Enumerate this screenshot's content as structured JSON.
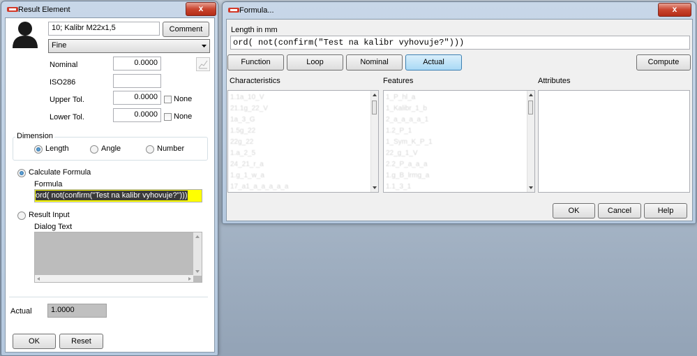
{
  "result_window": {
    "title": "Result Element",
    "close_label": "x",
    "name_value": "10; Kalibr M22x1,5",
    "comment_label": "Comment",
    "quality_select": "Fine",
    "nominal_label": "Nominal",
    "nominal_value": "0.0000",
    "iso_label": "ISO286",
    "iso_value": "",
    "upper_label": "Upper Tol.",
    "upper_value": "0.0000",
    "upper_none": "None",
    "lower_label": "Lower Tol.",
    "lower_value": "0.0000",
    "lower_none": "None",
    "dimension_label": "Dimension",
    "dim_length": "Length",
    "dim_angle": "Angle",
    "dim_number": "Number",
    "calc_label": "Calculate Formula",
    "formula_label": "Formula",
    "formula_value": "ord( not(confirm(\"Test na kalibr vyhovuje?\")))",
    "result_input_label": "Result Input",
    "dialog_text_label": "Dialog Text",
    "actual_label": "Actual",
    "actual_value": "1.0000",
    "ok_label": "OK",
    "reset_label": "Reset"
  },
  "formula_window": {
    "title": "Formula...",
    "close_label": "x",
    "header": "Length in mm",
    "formula_value": "ord( not(confirm(\"Test na kalibr vyhovuje?\")))",
    "tabs": [
      "Function",
      "Loop",
      "Nominal",
      "Actual"
    ],
    "active_tab": "Actual",
    "compute_label": "Compute",
    "characteristics_label": "Characteristics",
    "features_label": "Features",
    "attributes_label": "Attributes",
    "characteristics_items": [
      "1.1a_10_V",
      "21.1g_22_V",
      "1a_3_G",
      "1.5g_22",
      "22g_22",
      "1.a_2_5",
      "24_21_r_a",
      "1.g_1_w_a",
      "17_a1_a_a_a_a_a"
    ],
    "features_items": [
      "1_P_hl_a",
      "1_Kalibr_1_b",
      "2_a_a_a_a_1",
      "1.2_P_1",
      "1_Sym_K_P_1",
      "22_g_1_V",
      "2.2_P_a_a_a",
      "1.g_B_lrmg_a",
      "1.1_3_1"
    ],
    "ok_label": "OK",
    "cancel_label": "Cancel",
    "help_label": "Help"
  }
}
